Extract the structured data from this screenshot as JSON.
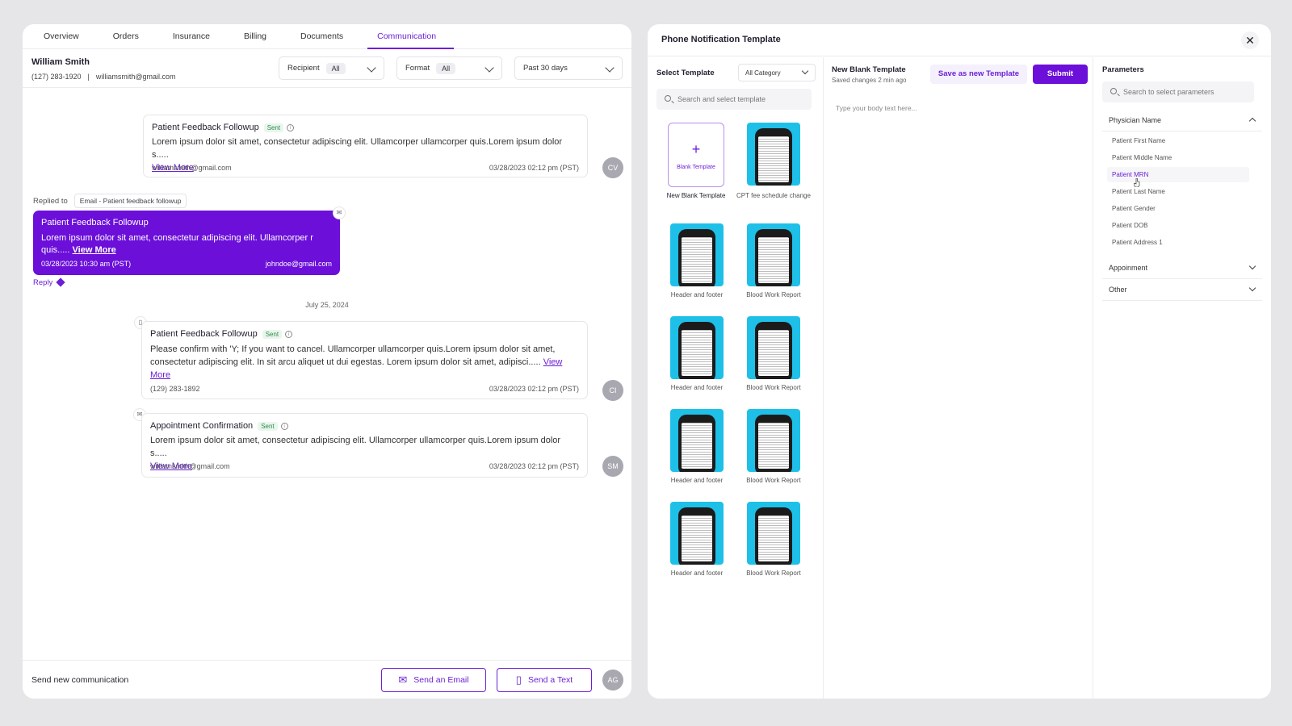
{
  "tabs": [
    "Overview",
    "Orders",
    "Insurance",
    "Billing",
    "Documents",
    "Communication"
  ],
  "active_tab": "Communication",
  "patient": {
    "name": "William Smith",
    "phone": "(127) 283-1920",
    "separator": "|",
    "email": "williamsmith@gmail.com"
  },
  "filters": {
    "recipient_label": "Recipient",
    "recipient_value": "All",
    "format_label": "Format",
    "format_value": "All",
    "range_value": "Past 30 days"
  },
  "messages": [
    {
      "title": "Patient Feedback Followup",
      "status": "Sent",
      "body": "Lorem ipsum dolor sit amet, consectetur adipiscing elit. Ullamcorper ullamcorper quis.Lorem ipsum dolor s.....",
      "view_more": "View More",
      "meta": "williamsmith@gmail.com",
      "time": "03/28/2023  02:12 pm (PST)",
      "avatar": "CV"
    },
    {
      "title": "Patient Feedback Followup",
      "status": "Sent",
      "body": "Please confirm with 'Y; If you want to cancel. Ullamcorper ullamcorper quis.Lorem ipsum dolor sit amet, consectetur adipiscing elit. In sit arcu aliquet ut dui egestas. Lorem ipsum dolor sit amet, adipisci.....",
      "view_more": "View More",
      "meta": "(129) 283-1892",
      "time": "03/28/2023  02:12 pm (PST)",
      "avatar": "CI"
    },
    {
      "title": "Appointment Confirmation",
      "status": "Sent",
      "body": "Lorem ipsum dolor sit amet, consectetur adipiscing elit. Ullamcorper ullamcorper quis.Lorem ipsum dolor s.....",
      "view_more": "View More",
      "meta": "williamsmith@gmail.com",
      "time": "03/28/2023  02:12 pm (PST)",
      "avatar": "SM"
    }
  ],
  "reply_context": {
    "replied_to_label": "Replied to",
    "replied_to_value": "Email - Patient feedback followup",
    "title": "Patient Feedback Followup",
    "body": "Lorem ipsum dolor sit amet, consectetur adipiscing elit. Ullamcorper  r quis.....",
    "view_more": "View More",
    "date": "03/28/2023  10:30 am (PST)",
    "email": "johndoe@gmail.com",
    "reply_label": "Reply"
  },
  "date_separator": "July 25, 2024",
  "footer": {
    "label": "Send new communication",
    "send_email": "Send an Email",
    "send_text": "Send a Text",
    "avatar": "AG"
  },
  "modal": {
    "title": "Phone Notification Template",
    "select_template_label": "Select Template",
    "category_value": "All Category",
    "template_search_placeholder": "Search and select template",
    "blank_tile_label": "Blank Template",
    "templates": [
      "New Blank Template",
      "CPT fee schedule change",
      "Header and footer",
      "Blood Work Report",
      "Header and footer",
      "Blood Work Report",
      "Header and footer",
      "Blood Work Report",
      "Header and footer",
      "Blood Work Report"
    ],
    "editor": {
      "title": "New Blank Template",
      "subtitle": "Saved changes 2 min ago",
      "save_as_new": "Save as new Template",
      "submit": "Submit",
      "body_placeholder": "Type your body text here..."
    },
    "parameters": {
      "title": "Parameters",
      "search_placeholder": "Search to select parameters",
      "groups": [
        "Physician Name",
        "Appoinment",
        "Other"
      ],
      "items": [
        "Patient First Name",
        "Patient Middle Name",
        "Patient MRN",
        "Patient Last Name",
        "Patient Gender",
        "Patient DOB",
        "Patient Address 1"
      ],
      "selected": "Patient MRN"
    }
  },
  "colors": {
    "accent": "#6b0fd9",
    "thumb_bg": "#1ec0e8",
    "sent_badge": "#2f8a4e"
  }
}
